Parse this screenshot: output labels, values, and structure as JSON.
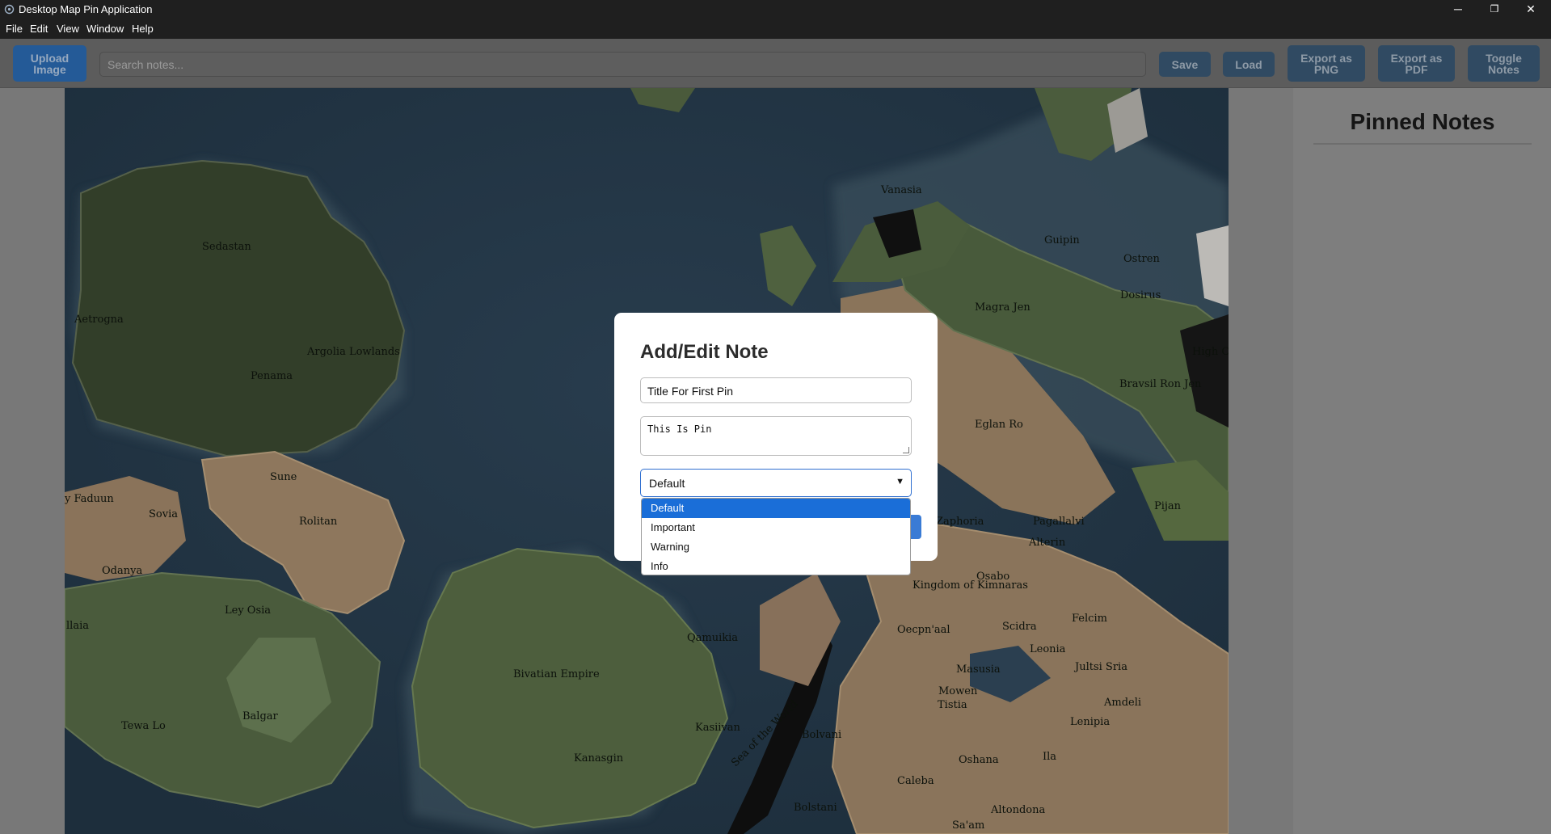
{
  "window": {
    "title": "Desktop Map Pin Application",
    "controls": {
      "minimize": "─",
      "maximize": "❐",
      "close": "✕"
    }
  },
  "menu": [
    "File",
    "Edit",
    "View",
    "Window",
    "Help"
  ],
  "toolbar": {
    "upload_label": "Upload Image",
    "search_placeholder": "Search notes...",
    "save_label": "Save",
    "load_label": "Load",
    "export_png_label": "Export as PNG",
    "export_pdf_label": "Export as PDF",
    "toggle_notes_label": "Toggle Notes"
  },
  "map": {
    "places": [
      "Sedastan",
      "Aetrogna",
      "Argolia Lowlands",
      "Penama",
      "Vanasia",
      "Guipin",
      "Ostren",
      "Dosirus",
      "Magra Jen",
      "High C",
      "Bravsil Ron Jen",
      "Eglan Ro",
      "Sune",
      "Rolitan",
      "y Faduun",
      "Sovia",
      "Odanya",
      "Ley Osia",
      "llaia",
      "Tewa Lo",
      "Balgar",
      "Bivatian Empire",
      "Qamuikia",
      "Kasiivan",
      "Kanasgin",
      "Sea of the World",
      "Bolvani",
      "Bolstani",
      "Zaphoria",
      "Pagallalvi",
      "Pijan",
      "Alterin",
      "Osabo",
      "Kingdom of Kimnaras",
      "Oecpn'aal",
      "Scidra",
      "Felcim",
      "Leonia",
      "Jultsi Sria",
      "Masusia",
      "Mowen",
      "Amdeli",
      "Lenipia",
      "Tistia",
      "Ila",
      "Oshana",
      "Caleba",
      "Altondona",
      "Sa'am"
    ]
  },
  "notes_panel": {
    "heading": "Pinned Notes"
  },
  "modal": {
    "heading": "Add/Edit Note",
    "title_value": "Title For First Pin",
    "body_value": "This Is Pin",
    "type_value": "Default",
    "type_options": [
      "Default",
      "Important",
      "Warning",
      "Info"
    ]
  }
}
